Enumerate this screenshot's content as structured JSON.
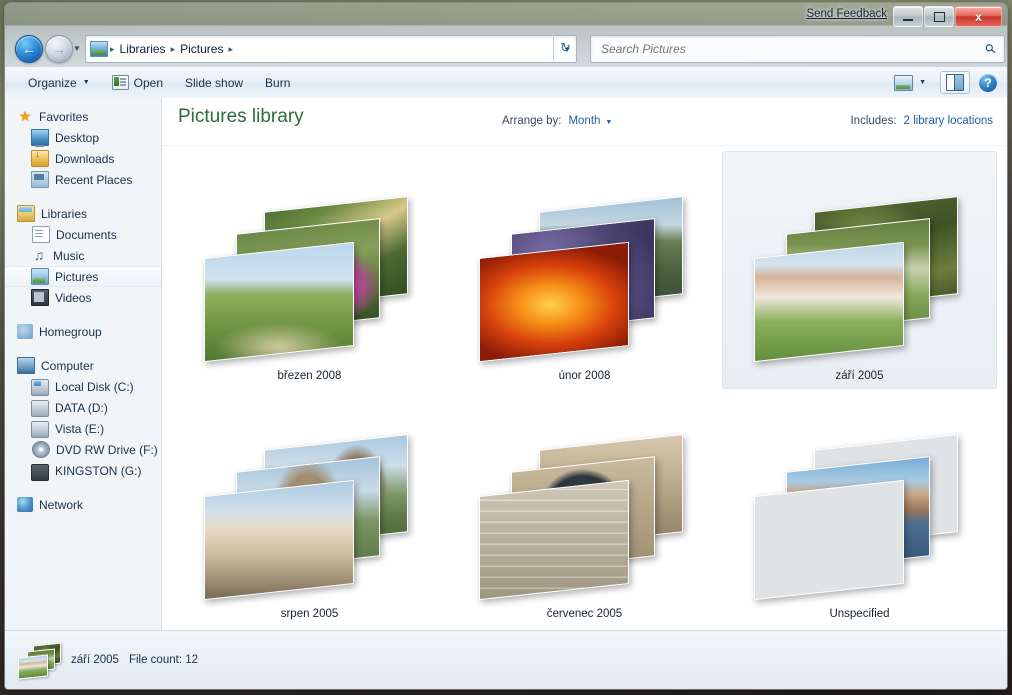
{
  "titlebar": {
    "send_feedback": "Send Feedback",
    "minimize_label": "Minimize",
    "maximize_label": "Maximize",
    "close_label": "x"
  },
  "address": {
    "back_arrow": "←",
    "forward_arrow": "→",
    "history_caret": "▼",
    "crumbs": [
      "Libraries",
      "Pictures"
    ],
    "separator": "▸",
    "dropdown_caret": "▼",
    "refresh_glyph": "↻"
  },
  "search": {
    "placeholder": "Search Pictures",
    "value": "",
    "icon_glyph": "⚲"
  },
  "toolbar": {
    "organize": "Organize",
    "organize_caret": "▼",
    "open": "Open",
    "slide_show": "Slide show",
    "burn": "Burn",
    "view_caret": "▼",
    "help_glyph": "?"
  },
  "sidebar": {
    "groups": [
      {
        "header": {
          "label": "Favorites",
          "icon": "star-icon"
        },
        "items": [
          {
            "label": "Desktop",
            "icon": "desktop-icon"
          },
          {
            "label": "Downloads",
            "icon": "downloads-icon"
          },
          {
            "label": "Recent Places",
            "icon": "recent-places-icon"
          }
        ]
      },
      {
        "header": {
          "label": "Libraries",
          "icon": "library-icon"
        },
        "items": [
          {
            "label": "Documents",
            "icon": "documents-icon"
          },
          {
            "label": "Music",
            "icon": "music-icon"
          },
          {
            "label": "Pictures",
            "icon": "pictures-icon",
            "selected": true
          },
          {
            "label": "Videos",
            "icon": "videos-icon"
          }
        ]
      },
      {
        "header": {
          "label": "Homegroup",
          "icon": "homegroup-icon"
        },
        "items": []
      },
      {
        "header": {
          "label": "Computer",
          "icon": "computer-icon"
        },
        "items": [
          {
            "label": "Local Disk (C:)",
            "icon": "system-drive-icon"
          },
          {
            "label": "DATA (D:)",
            "icon": "hard-drive-icon"
          },
          {
            "label": "Vista (E:)",
            "icon": "hard-drive-icon"
          },
          {
            "label": "DVD RW Drive (F:)",
            "icon": "optical-drive-icon"
          },
          {
            "label": "KINGSTON (G:)",
            "icon": "usb-drive-icon"
          }
        ]
      },
      {
        "header": {
          "label": "Network",
          "icon": "network-icon"
        },
        "items": []
      }
    ]
  },
  "library": {
    "title": "Pictures library",
    "arrange_by_label": "Arrange by:",
    "arrange_by_value": "Month",
    "arrange_caret": "▼",
    "includes_label": "Includes:",
    "includes_value": "2 library locations"
  },
  "grid": {
    "tiles": [
      {
        "label": "březen 2008",
        "selected": false,
        "art": [
          "art-butterfly",
          "art-flowers",
          "art-meadow"
        ]
      },
      {
        "label": "únor 2008",
        "selected": false,
        "art": [
          "art-landscape",
          "art-grapes",
          "art-rose"
        ]
      },
      {
        "label": "září 2005",
        "selected": true,
        "art": [
          "art-trees",
          "art-garden",
          "art-villa"
        ]
      },
      {
        "label": "srpen 2005",
        "selected": false,
        "art": [
          "art-castle",
          "art-tower",
          "art-town"
        ]
      },
      {
        "label": "červenec 2005",
        "selected": false,
        "art": [
          "art-facade",
          "art-window",
          "art-stone"
        ]
      },
      {
        "label": "Unspecified",
        "selected": false,
        "art": [
          "art-screenshot-a",
          "art-mountain",
          "art-screenshot-b"
        ]
      }
    ]
  },
  "statusbar": {
    "name": "září 2005",
    "file_count": "File count: 12"
  },
  "colors": {
    "library_title_green": "#2d6b3f",
    "link_blue": "#1f5fa8",
    "close_red": "#c8352a",
    "sidebar_bg": "#f2f5f8"
  }
}
